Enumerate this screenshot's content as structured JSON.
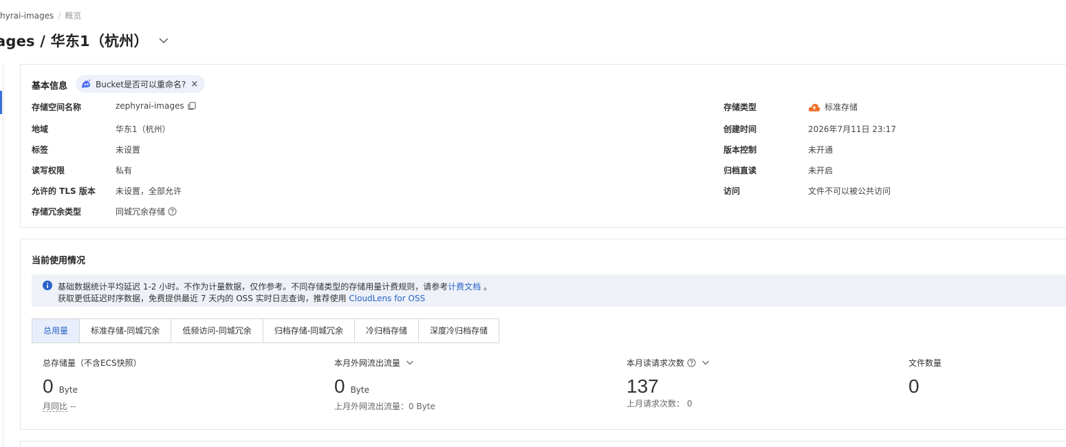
{
  "breadcrumb": {
    "bucket": "hyrai-images",
    "current": "概览"
  },
  "page": {
    "title": "ages / 华东1（杭州）"
  },
  "basic": {
    "title": "基本信息",
    "ai_chip": "Bucket是否可以重命名?",
    "left": [
      {
        "label": "存储空间名称",
        "value": "zephyrai-images"
      },
      {
        "label": "地域",
        "value": "华东1（杭州）"
      },
      {
        "label": "标签",
        "value": "未设置"
      },
      {
        "label": "读写权限",
        "value": "私有"
      },
      {
        "label": "允许的 TLS 版本",
        "value": "未设置，全部允许"
      },
      {
        "label": "存储冗余类型",
        "value": "同城冗余存储"
      }
    ],
    "right": [
      {
        "label": "存储类型",
        "value": "标准存储"
      },
      {
        "label": "创建时间",
        "value": "2026年7月11日 23:17"
      },
      {
        "label": "版本控制",
        "value": "未开通"
      },
      {
        "label": "归档直读",
        "value": "未开启"
      },
      {
        "label": "访问",
        "value": "文件不可以被公共访问"
      }
    ]
  },
  "usage": {
    "title": "当前使用情况",
    "notice": {
      "line1_text": "基础数据统计平均延迟 1-2 小时。不作为计量数据，仅作参考。不同存储类型的存储用量计费规则，请参考",
      "line1_link": "计费文档",
      "line1_end": " 。",
      "line2_text": "获取更低延迟时序数据，免费提供最近 7 天内的 OSS 实时日志查询，推荐使用 ",
      "line2_link": "CloudLens for OSS"
    },
    "tabs": [
      "总用量",
      "标准存储-同城冗余",
      "低频访问-同城冗余",
      "归档存储-同城冗余",
      "冷归档存储",
      "深度冷归档存储"
    ],
    "active_tab": 0,
    "metrics": [
      {
        "label": "总存储量（不含ECS快照）",
        "value": "0",
        "unit": "Byte",
        "sub_label": "月同比",
        "sub_value": " --"
      },
      {
        "label": "本月外网流出流量",
        "value": "0",
        "unit": "Byte",
        "sub_label": "上月外网流出流量：",
        "sub_value": "0 Byte"
      },
      {
        "label": "本月读请求次数",
        "value": "137",
        "unit": "",
        "sub_label": "上月请求次数：",
        "sub_value": "  0"
      },
      {
        "label": "文件数量",
        "value": "0",
        "unit": "",
        "sub_label": "",
        "sub_value": ""
      }
    ]
  },
  "colors": {
    "accent": "#2a62c9",
    "storage_icon": "#f0702c",
    "notice_bg": "#eef2f8"
  },
  "icons": {
    "copy": "copy-icon",
    "help": "help-icon",
    "info": "info-icon",
    "dropdown": "chevron-down-icon",
    "ai": "ai-assistant-icon",
    "storage": "cloud-storage-icon"
  }
}
